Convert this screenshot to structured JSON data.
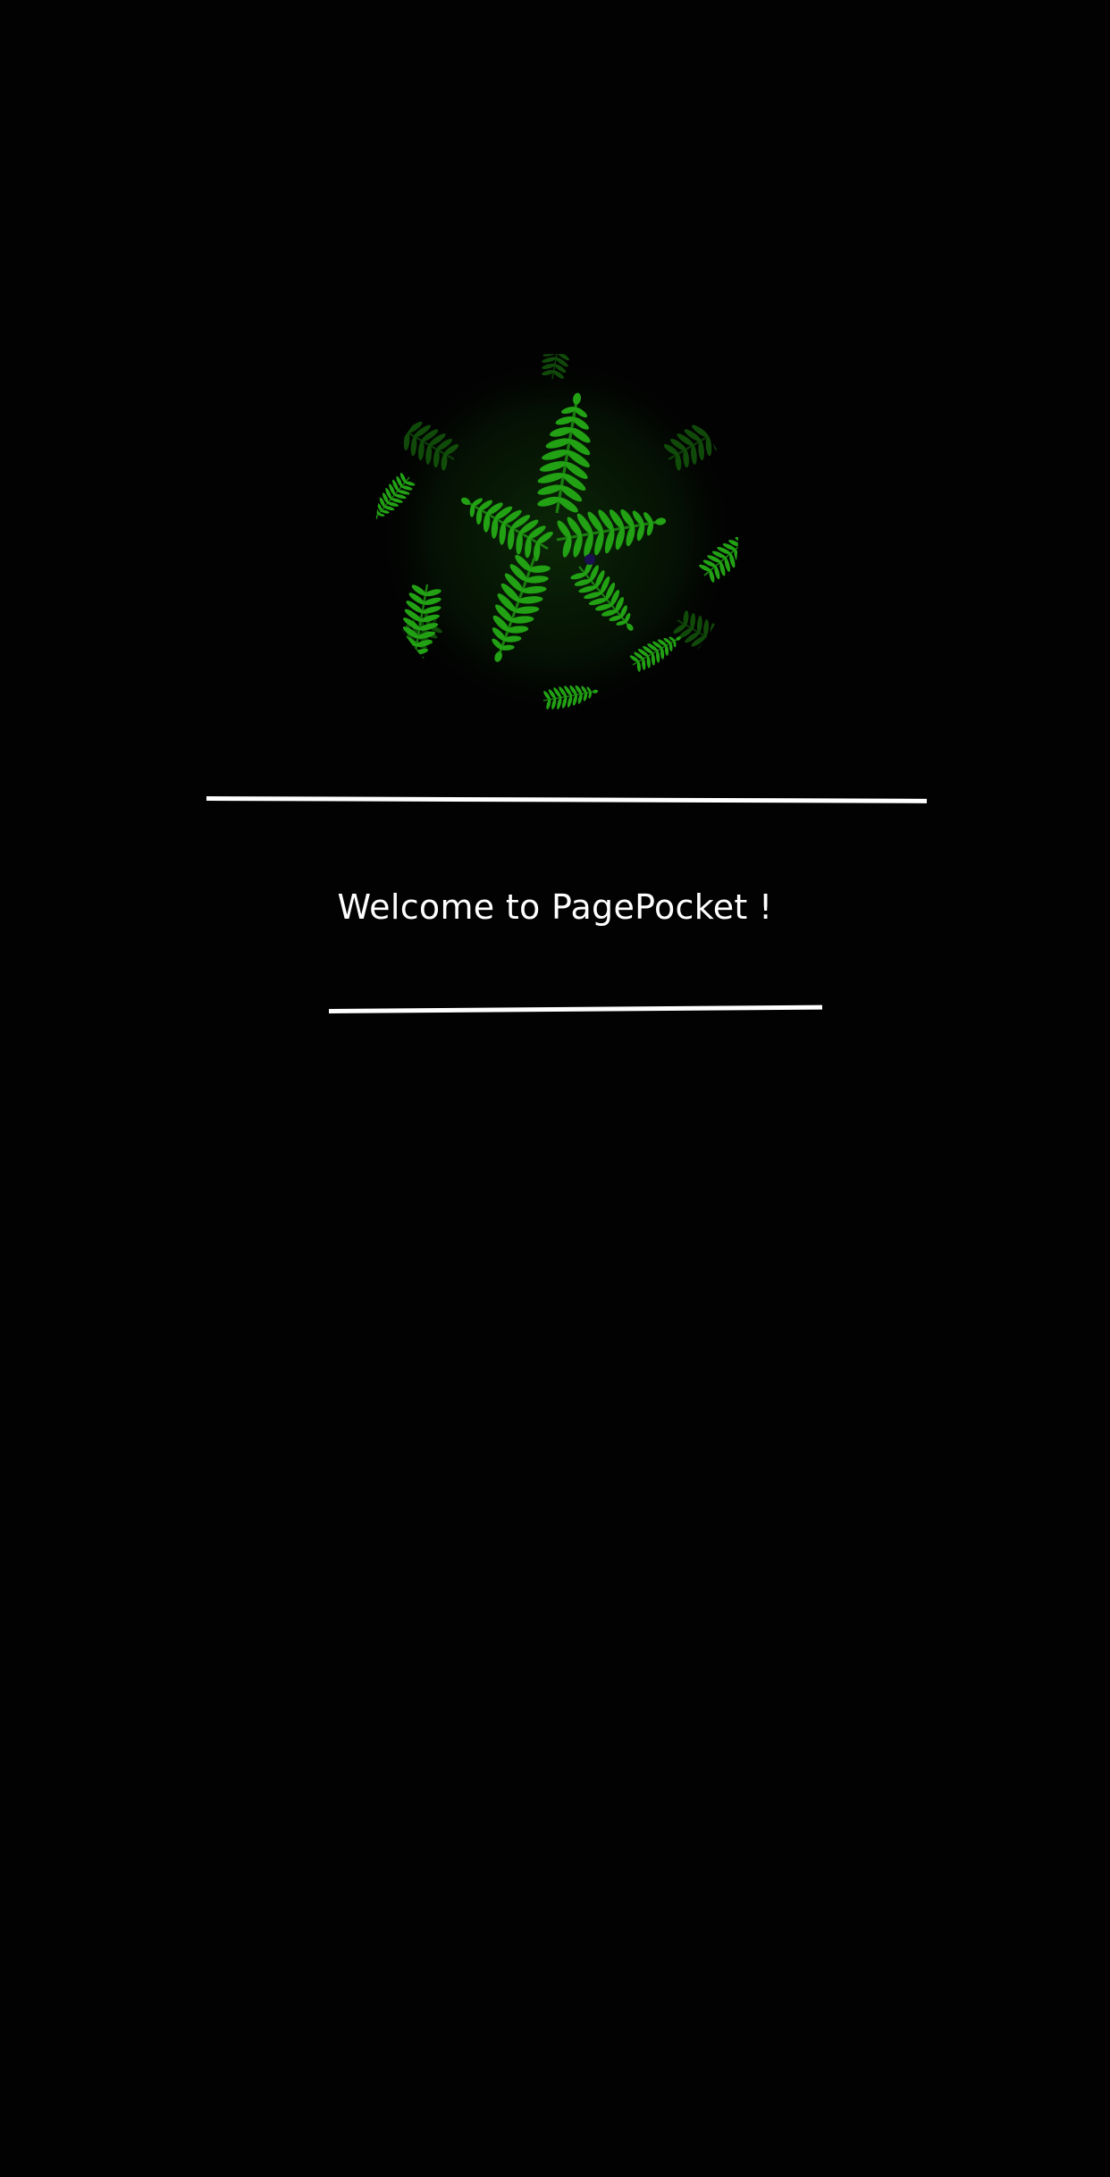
{
  "welcome": {
    "title": "Welcome to PagePocket !"
  },
  "logo": {
    "icon": "fern-leaves-globe-icon",
    "colors": {
      "leaf": "#1f9a12",
      "leaf_dark": "#0f5a08",
      "background": "#020202"
    }
  },
  "colors": {
    "background": "#020202",
    "text": "#ffffff",
    "divider": "#ffffff"
  }
}
